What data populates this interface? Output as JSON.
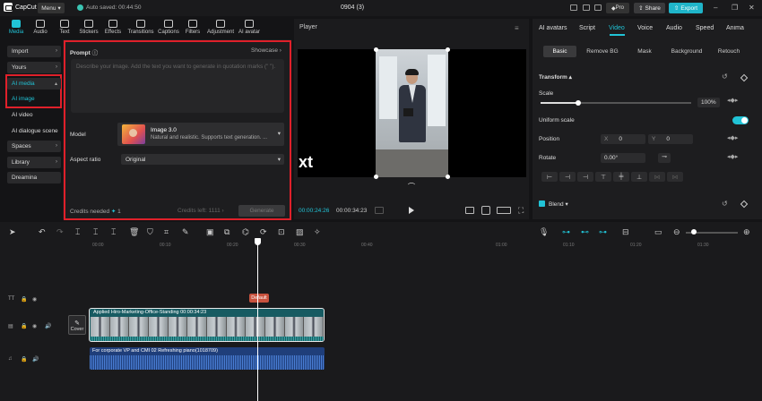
{
  "titlebar": {
    "app_name": "CapCut",
    "menu_label": "Menu",
    "autosave": "Auto saved: 00:44:50",
    "project_title": "0904 (3)",
    "pro_label": "Pro",
    "share_label": "Share",
    "export_label": "Export"
  },
  "tools": [
    {
      "label": "Media",
      "icon": "media-icon"
    },
    {
      "label": "Audio",
      "icon": "audio-icon"
    },
    {
      "label": "Text",
      "icon": "text-icon"
    },
    {
      "label": "Stickers",
      "icon": "stickers-icon"
    },
    {
      "label": "Effects",
      "icon": "effects-icon"
    },
    {
      "label": "Transitions",
      "icon": "transitions-icon"
    },
    {
      "label": "Captions",
      "icon": "captions-icon"
    },
    {
      "label": "Filters",
      "icon": "filters-icon"
    },
    {
      "label": "Adjustment",
      "icon": "adjustment-icon"
    },
    {
      "label": "AI avatar",
      "icon": "ai-avatar-icon"
    }
  ],
  "sidebar": {
    "import": "Import",
    "yours": "Yours",
    "ai_media": "AI media",
    "ai_image": "AI image",
    "ai_video": "AI video",
    "ai_dialogue": "AI dialogue scene",
    "spaces": "Spaces",
    "library": "Library",
    "dreamina": "Dreamina"
  },
  "ai_panel": {
    "prompt_label": "Prompt",
    "showcase": "Showcase",
    "placeholder": "Describe your image. Add the text you want to generate in quotation marks (\" \").",
    "model_label": "Model",
    "model_name": "Image 3.0",
    "model_desc": "Natural and realistic. Supports text generation. ...",
    "aspect_label": "Aspect ratio",
    "aspect_value": "Original",
    "credits_needed": "Credits needed",
    "credits_value": "1",
    "credits_left": "Credits left: 1111",
    "generate": "Generate"
  },
  "player": {
    "title": "Player",
    "overlay_text": "xt",
    "current_time": "00:00:24:26",
    "total_time": "00:00:34:23"
  },
  "right_panel": {
    "tabs": [
      "AI avatars",
      "Script",
      "Video",
      "Voice",
      "Audio",
      "Speed",
      "Anima"
    ],
    "subtabs": [
      "Basic",
      "Remove BG",
      "Mask",
      "Background",
      "Retouch"
    ],
    "transform": "Transform",
    "scale_label": "Scale",
    "scale_value": "100%",
    "scale_level": 0.25,
    "uniform_scale": "Uniform scale",
    "position_label": "Position",
    "pos_x_label": "X",
    "pos_x": "0",
    "pos_y_label": "Y",
    "pos_y": "0",
    "rotate_label": "Rotate",
    "rotate_value": "0.00°",
    "blend_label": "Blend"
  },
  "timeline": {
    "ticks": [
      "00:00",
      "00:10",
      "00:20",
      "00:30",
      "00:40",
      "01:00",
      "01:10",
      "01:20",
      "01:30"
    ],
    "default_label": "Default",
    "video_clip_label": "Applied   Hiro-Marketing-Office-Standing   00:00:34:23",
    "cover_label": "Cover",
    "audio_clip_label": "For corporate VP and CMI 02 Refreshing piano(1018709)"
  },
  "colors": {
    "accent": "#21c3d6",
    "highlight": "#e0202a",
    "video_clip": "#175b62",
    "audio_clip": "#1f3e7a"
  }
}
